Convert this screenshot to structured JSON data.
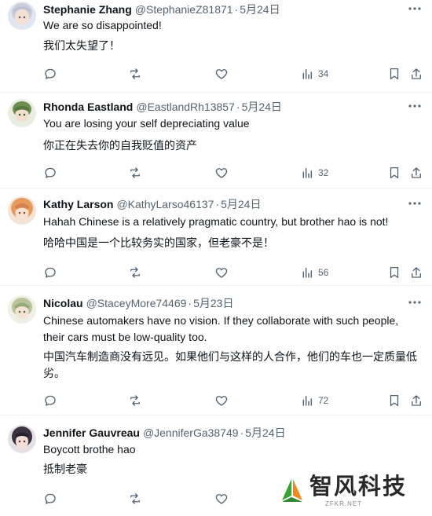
{
  "tweets": [
    {
      "name": "Stephanie Zhang",
      "handle": "@StephanieZ81871",
      "dot": "·",
      "date": "5月24日",
      "text_en": "We are so disappointed!",
      "text_zh": "我们太失望了！",
      "views": "34",
      "avatar_colors": {
        "bg": "#dfe6f2",
        "hair": "#c9cdd9",
        "face": "#f5ded2"
      }
    },
    {
      "name": "Rhonda Eastland",
      "handle": "@EastlandRh13857",
      "dot": "·",
      "date": "5月24日",
      "text_en": "You are losing your self depreciating value",
      "text_zh": "你正在失去你的自我贬值的资产",
      "views": "32",
      "avatar_colors": {
        "bg": "#e8efe2",
        "hair": "#6e8f52",
        "face": "#f3dfcf"
      }
    },
    {
      "name": "Kathy Larson",
      "handle": "@KathyLarso46137",
      "dot": "·",
      "date": "5月24日",
      "text_en": "Hahah Chinese is a relatively pragmatic country, but brother hao is not!",
      "text_zh": "哈哈中国是一个比较务实的国家，但老豪不是！",
      "views": "56",
      "avatar_colors": {
        "bg": "#f3e3d6",
        "hair": "#e59a5c",
        "face": "#f7e1d3"
      }
    },
    {
      "name": "Nicolau",
      "handle": "@StaceyMore74469",
      "dot": "·",
      "date": "5月23日",
      "text_en": "Chinese automakers have no vision. If they collaborate with such people, their cars must be low-quality too.",
      "text_zh": "中国汽车制造商没有远见。如果他们与这样的人合作，他们的车也一定质量低劣。",
      "views": "72",
      "avatar_colors": {
        "bg": "#eef0e6",
        "hair": "#b9c49a",
        "face": "#f4e3d5"
      }
    },
    {
      "name": "Jennifer Gauvreau",
      "handle": "@JenniferGa38749",
      "dot": "·",
      "date": "5月24日",
      "text_en": "Boycott brothe hao",
      "text_zh": "抵制老豪",
      "views": "",
      "avatar_colors": {
        "bg": "#e4e0e6",
        "hair": "#3a3340",
        "face": "#f2dfd6"
      }
    }
  ],
  "watermark": {
    "name": "智风科技",
    "url": "ZFKR.NET",
    "colors": {
      "green": "#3aa335",
      "orange": "#f08a1c"
    }
  },
  "icons": {
    "reply": "reply-icon",
    "retweet": "retweet-icon",
    "like": "heart-icon",
    "views": "views-icon",
    "bookmark": "bookmark-icon",
    "share": "share-icon",
    "more": "more-icon"
  },
  "colors": {
    "text": "#0f1419",
    "muted": "#536471",
    "divider": "#eff3f4"
  }
}
